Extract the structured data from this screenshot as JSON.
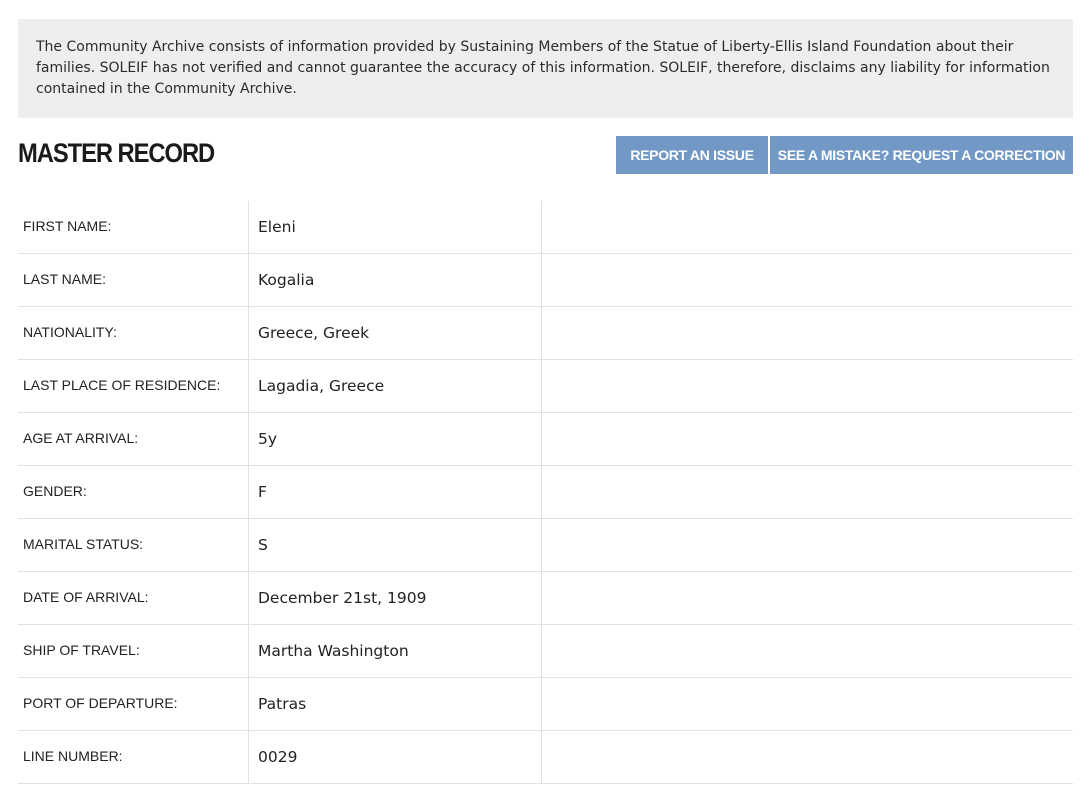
{
  "notice": {
    "text": "The Community Archive consists of information provided by Sustaining Members of the Statue of Liberty-Ellis Island Foundation about their families. SOLEIF has not verified and cannot guarantee the accuracy of this information. SOLEIF, therefore, disclaims any liability for information contained in the Community Archive."
  },
  "header": {
    "title": "MASTER RECORD",
    "report_button": "REPORT AN ISSUE",
    "correction_button": "SEE A MISTAKE? REQUEST A CORRECTION"
  },
  "colors": {
    "button_bg": "#7299c6",
    "notice_bg": "#eceef0"
  },
  "record": [
    {
      "label": "FIRST NAME:",
      "value": "Eleni"
    },
    {
      "label": "LAST NAME:",
      "value": "Kogalia"
    },
    {
      "label": "NATIONALITY:",
      "value": "Greece, Greek"
    },
    {
      "label": "LAST PLACE OF RESIDENCE:",
      "value": "Lagadia, Greece"
    },
    {
      "label": "AGE AT ARRIVAL:",
      "value": "5y"
    },
    {
      "label": "GENDER:",
      "value": "F"
    },
    {
      "label": "MARITAL STATUS:",
      "value": "S"
    },
    {
      "label": "DATE OF ARRIVAL:",
      "value": "December 21st, 1909"
    },
    {
      "label": "SHIP OF TRAVEL:",
      "value": "Martha Washington"
    },
    {
      "label": "PORT OF DEPARTURE:",
      "value": "Patras"
    },
    {
      "label": "LINE NUMBER:",
      "value": "0029"
    }
  ]
}
